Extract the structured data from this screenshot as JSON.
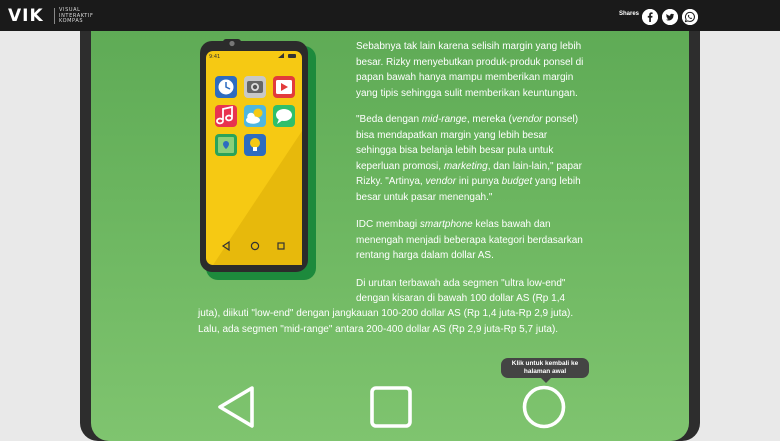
{
  "header": {
    "logo": "VIK",
    "logo_sub_1": "VISUAL",
    "logo_sub_2": "INTERAKTIF",
    "logo_sub_3": "KOMPAS",
    "shares_label": "Shares",
    "share_icons": [
      "facebook-icon",
      "twitter-icon",
      "whatsapp-icon"
    ]
  },
  "article": {
    "p1": [
      {
        "t": "Sebabnya tak lain karena selisih margin yang lebih"
      },
      {
        "t": "besar. Rizky menyebutkan produk-produk ponsel di"
      },
      {
        "t": "papan bawah hanya mampu memberikan margin"
      },
      {
        "t": "yang tipis sehingga sulit memberikan keuntungan."
      }
    ],
    "p2": [
      {
        "a": "\"Beda dengan ",
        "i": "mid-range",
        "b": ", mereka (",
        "i2": "vendor",
        "c": " ponsel)"
      },
      {
        "a": "bisa mendapatkan margin yang lebih besar"
      },
      {
        "a": "sehingga bisa belanja lebih besar pula untuk"
      },
      {
        "a": "keperluan promosi, ",
        "i": "marketing",
        "b": ", dan lain-lain,\" papar"
      },
      {
        "a": "Rizky. \"Artinya, ",
        "i": "vendor",
        "b": " ini punya ",
        "i2": "budget",
        "c": " yang lebih"
      },
      {
        "a": "besar untuk pasar menengah.\""
      }
    ],
    "p3": [
      {
        "a": "IDC membagi ",
        "i": "smartphone",
        "b": " kelas bawah dan"
      },
      {
        "a": "menengah menjadi beberapa kategori berdasarkan"
      },
      {
        "a": "rentang harga dalam dollar AS."
      }
    ],
    "p4_line1": "Di urutan terbawah ada segmen \"ultra low-end\"",
    "p4_line2": "dengan kisaran di bawah 100 dollar AS (Rp 1,4",
    "p4_line3": "juta), diikuti \"low-end\" dengan jangkauan 100-200 dollar AS (Rp 1,4 juta-Rp 2,9 juta).",
    "p4_line4": "Lalu, ada segmen \"mid-range\" antara 200-400 dollar AS (Rp 2,9 juta-Rp 5,7 juta)."
  },
  "phone_apps": [
    "clock-icon",
    "camera-icon",
    "video-icon",
    "music-icon",
    "weather-icon",
    "chat-icon",
    "map-icon",
    "idea-icon"
  ],
  "tooltip": {
    "line1": "Klik untuk kembali ke",
    "line2": "halaman awal"
  },
  "colors": {
    "topbar": "#1a1a1a",
    "screen_green": "#6bb55f",
    "phone_yellow": "#f6c913",
    "phone_shadow": "#1d8a3c"
  }
}
